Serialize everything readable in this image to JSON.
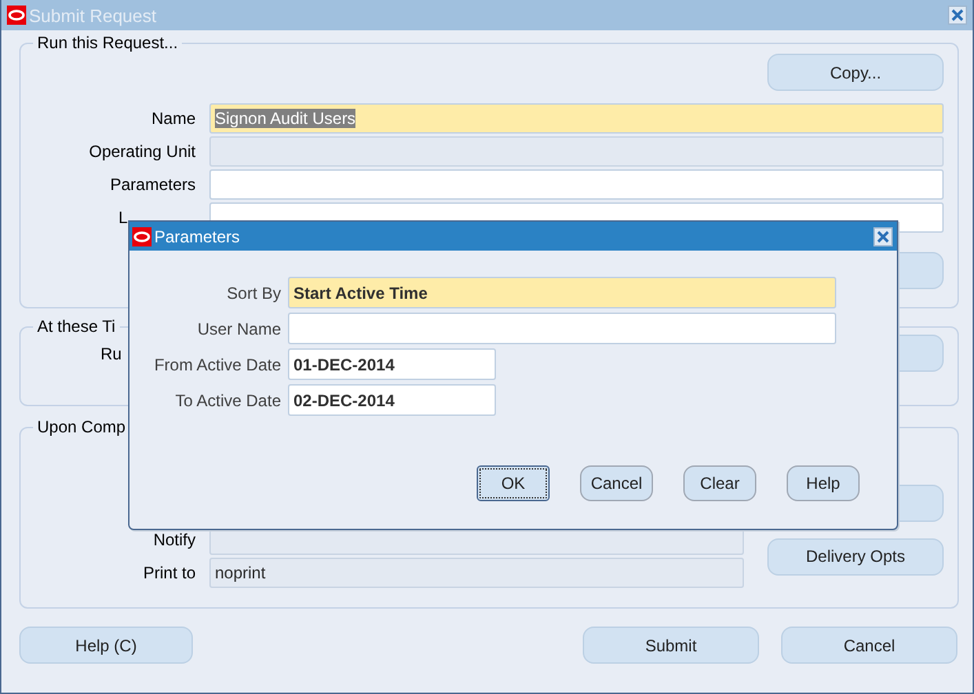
{
  "window": {
    "title": "Submit Request"
  },
  "run_group": {
    "title": "Run this Request...",
    "copy_button": {
      "label": "Copy..."
    },
    "fields": [
      {
        "label": "Name",
        "value": "Signon Audit Users",
        "required": true,
        "disabled": false,
        "text_selected": true,
        "kind": "full"
      },
      {
        "label": "Operating Unit",
        "required": false,
        "disabled": true,
        "kind": "full"
      },
      {
        "label": "Parameters",
        "required": false,
        "disabled": false,
        "kind": "full"
      },
      {
        "label": "L",
        "required": false,
        "disabled": false,
        "kind": "partial"
      }
    ]
  },
  "schedule_group": {
    "title": "At these Ti",
    "row_label": "Ru"
  },
  "completion_group": {
    "title": "Upon Comp",
    "fields": [
      {
        "label": "Notify",
        "required": false,
        "disabled": true
      },
      {
        "label": "Print to",
        "value": "noprint",
        "required": false,
        "disabled": true
      }
    ],
    "delivery_button": {
      "label": "Delivery Opts"
    }
  },
  "buttons": [
    {
      "label": "Help (C)"
    },
    {
      "label": "Submit"
    },
    {
      "label": "Cancel"
    }
  ],
  "dialog": {
    "title": "Parameters",
    "fields": [
      {
        "label": "Sort By",
        "value": "Start Active Time",
        "required": true,
        "disabled": false,
        "kind": "text"
      },
      {
        "label": "User Name",
        "required": false,
        "disabled": false,
        "kind": "text"
      },
      {
        "label": "From Active Date",
        "value": "01-DEC-2014",
        "required": false,
        "disabled": false,
        "kind": "date"
      },
      {
        "label": "To Active Date",
        "value": "02-DEC-2014",
        "required": false,
        "disabled": false,
        "kind": "date"
      }
    ],
    "buttons": [
      {
        "label": "OK",
        "focused": true
      },
      {
        "label": "Cancel",
        "focused": false
      },
      {
        "label": "Clear",
        "focused": false
      },
      {
        "label": "Help",
        "focused": false
      }
    ]
  }
}
